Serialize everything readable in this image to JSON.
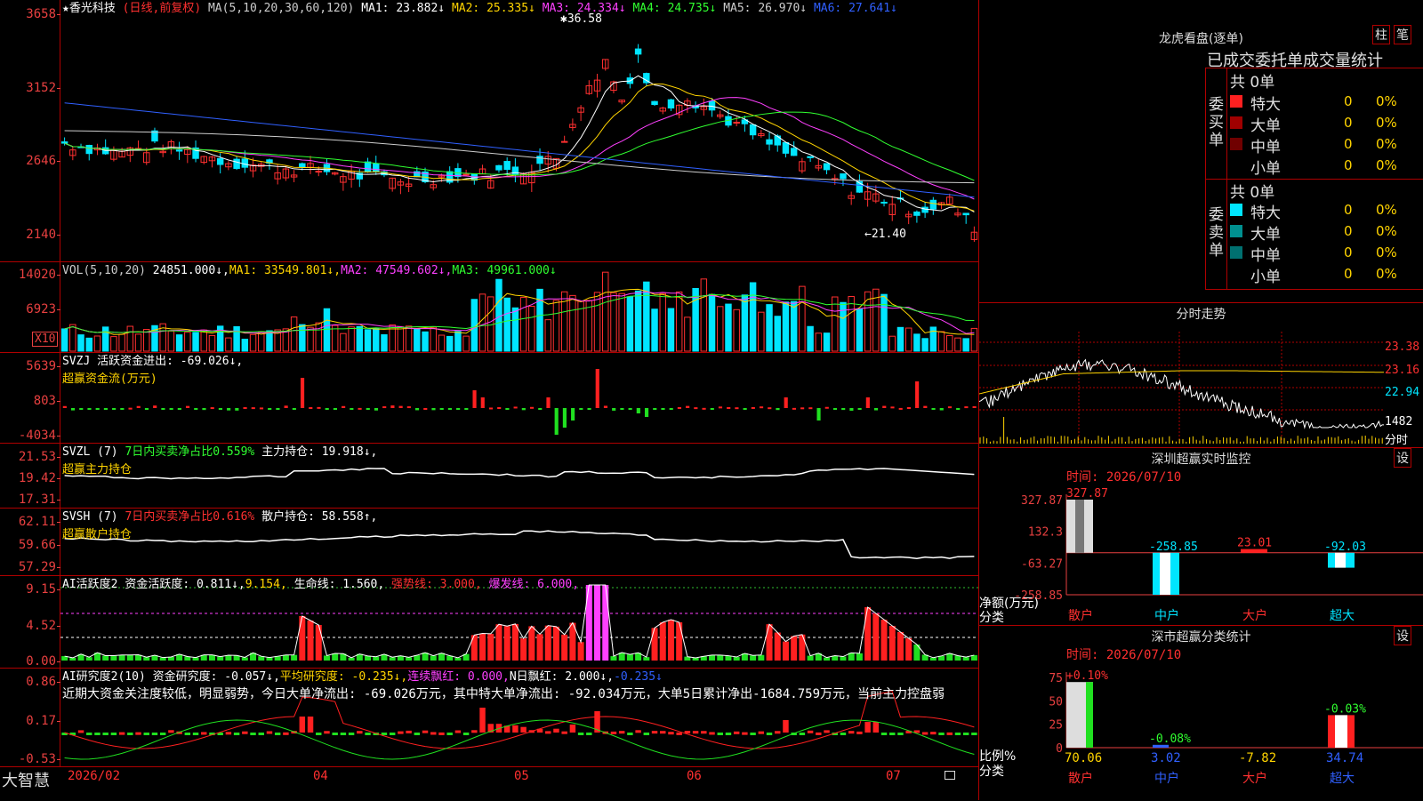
{
  "stock": {
    "name_prefix": "★",
    "name": "香光科技",
    "mode": "(日线,前复权)"
  },
  "kline": {
    "indicator_label": "MA(5,10,20,30,60,120)",
    "mas": [
      {
        "label": "MA1:",
        "value": "23.882↓",
        "color": "#ffffff"
      },
      {
        "label": "MA2:",
        "value": "25.335↓",
        "color": "#ffd400"
      },
      {
        "label": "MA3:",
        "value": "24.334↓",
        "color": "#ff40ff"
      },
      {
        "label": "MA4:",
        "value": "24.735↓",
        "color": "#30ff30"
      },
      {
        "label": "MA5:",
        "value": "26.970↓",
        "color": "#cccccc"
      },
      {
        "label": "MA6:",
        "value": "27.641↓",
        "color": "#3060ff"
      }
    ],
    "yticks": [
      "3658",
      "3152",
      "2646",
      "2140"
    ],
    "high_label": "36.58",
    "low_label": "←21.40"
  },
  "vol": {
    "label": "VOL(5,10,20)",
    "value": "24851.000↓,",
    "ma1": "MA1: 33549.801↓,",
    "ma2": "MA2: 47549.602↓,",
    "ma3": "MA3: 49961.000↓",
    "yticks": [
      "14020",
      "6923"
    ],
    "unit": "X10"
  },
  "svzj": {
    "label": "SVZJ",
    "text": "活跃资金进出: -69.026↓,",
    "sub": "超赢资金流(万元)",
    "yticks": [
      "5639",
      "803",
      "-4034"
    ]
  },
  "svzl": {
    "label": "SVZL (7)",
    "t1": "7日内买卖净占比0.559%",
    "t2": "主力持仓: 19.918↓,",
    "sub": "超赢主力持仓",
    "yticks": [
      "21.53",
      "19.42",
      "17.31"
    ]
  },
  "svsh": {
    "label": "SVSH (7)",
    "t1": "7日内买卖净占比0.616%",
    "t2": "散户持仓: 58.558↑,",
    "sub": "超赢散户持仓",
    "yticks": [
      "62.11",
      "59.66",
      "57.29"
    ]
  },
  "ai_act": {
    "label": "AI活跃度2",
    "t1": "资金活跃度: 0.811↓,",
    "t2": "9.154,",
    "t3": "生命线: 1.560,",
    "t4": "强势线: 3.000,",
    "t5": "爆发线: 6.000,",
    "yticks": [
      "9.15",
      "4.52",
      "0.00"
    ]
  },
  "ai_res": {
    "label": "AI研究度2(10)",
    "t1": "资金研究度: -0.057↓,",
    "t2": "平均研究度: -0.235↓,",
    "t3": "连续飘红: 0.000,",
    "t4": "N日飘红: 2.000↓,",
    "t5": "-0.235↓",
    "comment": "近期大资金关注度较低，明显弱势，今日大单净流出: -69.026万元，其中特大单净流出: -92.034万元，大单5日累计净出-1684.759万元，当前主力控盘弱",
    "yticks": [
      "0.86",
      "0.17",
      "-0.53"
    ]
  },
  "bottom_axis": {
    "logo": "大智慧",
    "dates": [
      "2026/02",
      "04",
      "05",
      "06",
      "07"
    ]
  },
  "longhu": {
    "title": "龙虎看盘(逐单)",
    "btn_bar": "柱",
    "btn_pen": "笔",
    "subtitle": "已成交委托单成交量统计",
    "buy_label": "委买单",
    "sell_label": "委卖单",
    "buy_total": "共 0单",
    "sell_total": "共 0单",
    "rows": [
      {
        "name": "特大",
        "count": "0",
        "pct": "0%"
      },
      {
        "name": "大单",
        "count": "0",
        "pct": "0%"
      },
      {
        "name": "中单",
        "count": "0",
        "pct": "0%"
      },
      {
        "name": "小单",
        "count": "0",
        "pct": "0%"
      }
    ],
    "buy_colors": [
      "#ff2020",
      "#a00000",
      "#700000"
    ],
    "sell_colors": [
      "#00e5ff",
      "#009090",
      "#007070"
    ]
  },
  "intraday": {
    "title": "分时走势",
    "yticks": [
      "23.38",
      "23.16",
      "22.94"
    ],
    "vol_tick": "1482",
    "vol_label": "分时"
  },
  "monitor": {
    "title": "深圳超赢实时监控",
    "btn": "设",
    "time": "时间: 2026/07/10",
    "yticks": [
      "327.87",
      "132.3",
      "-63.27",
      "-258.85"
    ],
    "ylabel1": "净额(万元)",
    "ylabel2": "分类",
    "categories": [
      "散户",
      "中户",
      "大户",
      "超大"
    ],
    "values": [
      327.87,
      -258.85,
      23.01,
      -92.03
    ],
    "value_labels": [
      "327.87",
      "-258.85",
      "23.01",
      "-92.03"
    ]
  },
  "classify": {
    "title": "深市超赢分类统计",
    "btn": "设",
    "time": "时间: 2026/07/10",
    "yticks": [
      "75",
      "50",
      "25",
      "0"
    ],
    "ylabel1": "比例%",
    "ylabel2": "分类",
    "categories": [
      "散户",
      "中户",
      "大户",
      "超大"
    ],
    "ratios": [
      70.06,
      3.02,
      0,
      34.74
    ],
    "bar_labels": [
      "+0.10%",
      "-0.08%",
      "",
      "-0.03%"
    ],
    "values": [
      "70.06",
      "3.02",
      "-7.82",
      "34.74"
    ]
  }
}
